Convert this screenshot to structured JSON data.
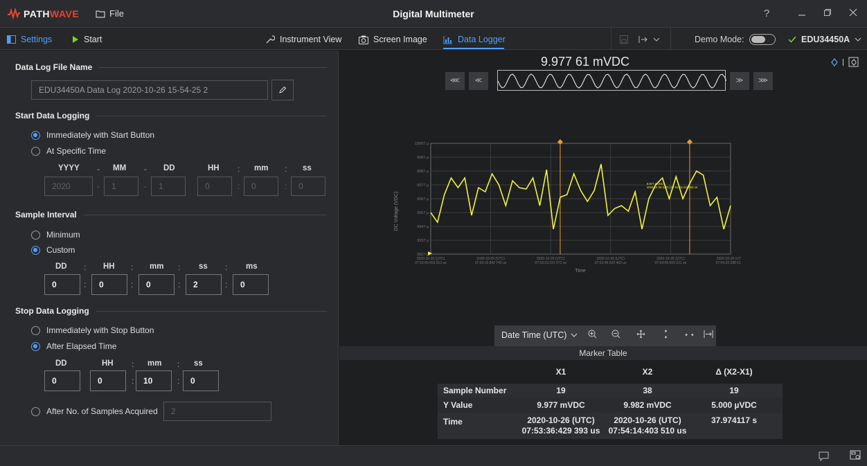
{
  "app": {
    "logo_part1": "PATH",
    "logo_part2": "WAVE",
    "file_menu": "File",
    "title": "Digital Multimeter",
    "help": "?"
  },
  "toolbar": {
    "settings": "Settings",
    "start": "Start",
    "instrument_view": "Instrument View",
    "screen_image": "Screen Image",
    "data_logger": "Data Logger",
    "demo_mode": "Demo Mode:",
    "instrument": "EDU34450A"
  },
  "data_log_file": {
    "title": "Data Log File Name",
    "value": "EDU34450A Data Log 2020-10-26 15-54-25 2"
  },
  "start_logging": {
    "title": "Start Data Logging",
    "option_immediate": "Immediately with Start Button",
    "option_specific": "At Specific Time",
    "headers": [
      "YYYY",
      "MM",
      "DD",
      "HH",
      "mm",
      "ss"
    ],
    "values": [
      "2020",
      "1",
      "1",
      "0",
      "0",
      "0"
    ],
    "separators": [
      "-",
      "-",
      ":",
      ":"
    ]
  },
  "sample_interval": {
    "title": "Sample Interval",
    "option_min": "Minimum",
    "option_custom": "Custom",
    "headers": [
      "DD",
      "HH",
      "mm",
      "ss",
      "ms"
    ],
    "values": [
      "0",
      "0",
      "0",
      "2",
      "0"
    ],
    "sep": ":"
  },
  "stop_logging": {
    "title": "Stop Data Logging",
    "option_immediate": "Immediately with Stop Button",
    "option_elapsed": "After Elapsed Time",
    "headers": [
      "DD",
      "HH",
      "mm",
      "ss"
    ],
    "values": [
      "0",
      "0",
      "10",
      "0"
    ],
    "option_samples": "After No. of Samples Acquired",
    "samples_value": "2",
    "sep": ":"
  },
  "readout": "9.977 61 mVDC",
  "chart_data": {
    "type": "line",
    "ylabel": "DC Voltage (VDC)",
    "xlabel": "Time",
    "y_ticks": [
      "10007 μ",
      "9997 μ",
      "9987 μ",
      "9977 μ",
      "9967 μ",
      "9957 μ",
      "9947 μ",
      "9937 μ",
      "9927 μ"
    ],
    "x_ticks": [
      "2020-10-26 (UTC)\n07:53:00.453 913 us",
      "2020-10-26 (UTC)\n07:53:16.842 743 us",
      "2020-10-26 (UTC)\n07:53:33.231 572 us",
      "2020-10-26 (UTC)\n07:53:49.620 402 us",
      "2020-10-26 (UTC)\n07:54:06.009 231 us",
      "2020-10-26 (UTC)\n07:54:22.398 61 us"
    ],
    "ylim": [
      9927,
      10007
    ],
    "series": [
      {
        "values": [
          9957,
          9950,
          9970,
          9982,
          9975,
          9982,
          9955,
          9975,
          9972,
          9985,
          9977,
          9962,
          9980,
          9975,
          9974,
          9982,
          9962,
          9988,
          9945,
          9968,
          9970,
          9985,
          9973,
          9965,
          9973,
          9992,
          9955,
          9960,
          9962,
          9958,
          9972,
          9945,
          9967,
          9977,
          9982,
          9967,
          9983,
          9967,
          9978,
          9987,
          9984,
          9962,
          9968,
          9945,
          9962
        ]
      }
    ],
    "markers": [
      {
        "label": "X1",
        "sample": 19
      },
      {
        "label": "X2",
        "sample": 38
      }
    ],
    "marker_annotation": "9.977 mVDC\n2020-10-26 (UTC) 07:54:02.411 663 us",
    "grid": true
  },
  "zoom_bar": {
    "axis_mode": "Date Time (UTC)"
  },
  "marker_table": {
    "title": "Marker Table",
    "columns": [
      "X1",
      "X2",
      "Δ (X2-X1)"
    ],
    "rows": [
      {
        "label": "Sample Number",
        "values": [
          "19",
          "38",
          "19"
        ]
      },
      {
        "label": "Y Value",
        "values": [
          "9.977 mVDC",
          "9.982 mVDC",
          "5.000 µVDC"
        ]
      },
      {
        "label": "Time",
        "values": [
          "2020-10-26 (UTC)\n07:53:36:429 393 us",
          "2020-10-26 (UTC)\n07:54:14:403 510 us",
          "37.974117 s"
        ]
      }
    ]
  },
  "colors": {
    "accent": "#4f9fff",
    "trace": "#f2f23a",
    "marker": "#e89a2a",
    "logo_red": "#e8452e"
  }
}
